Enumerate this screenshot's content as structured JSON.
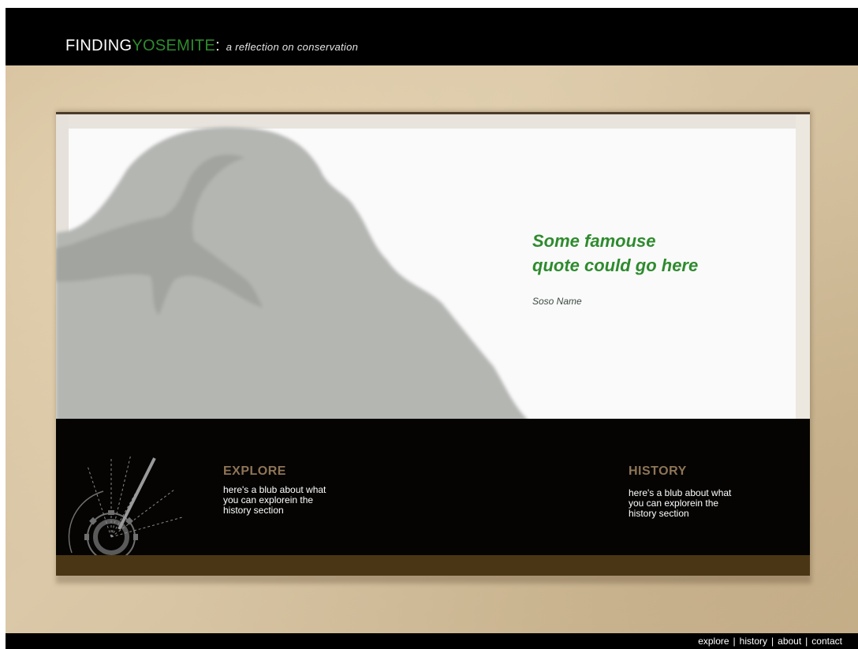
{
  "header": {
    "title_part1": "FINDING",
    "title_part2": "YOSEMITE",
    "title_colon": ":",
    "tagline": "a reflection on conservation"
  },
  "hero": {
    "quote_line1": "Some famouse",
    "quote_line2": "quote could go here",
    "author": "Soso Name"
  },
  "sections": {
    "explore": {
      "title": "EXPLORE",
      "text_line1": "here's a blub about what",
      "text_line2": "you can explorein the",
      "text_line3": "history section"
    },
    "history": {
      "title": "HISTORY",
      "text_line1": "here's a blub about what",
      "text_line2": "you can explorein the",
      "text_line3": "history section"
    }
  },
  "footer": {
    "nav": [
      "explore",
      "history",
      "about",
      "contact"
    ],
    "separator": "|"
  },
  "colors": {
    "brand_green": "#2e8b2e",
    "section_title_brown": "#8e7556",
    "bar_brown": "#4a3614",
    "background_tan": "#d3bf9c"
  },
  "icons": {
    "mountain": "half-dome-illustration",
    "compass": "compass-gear-illustration"
  }
}
